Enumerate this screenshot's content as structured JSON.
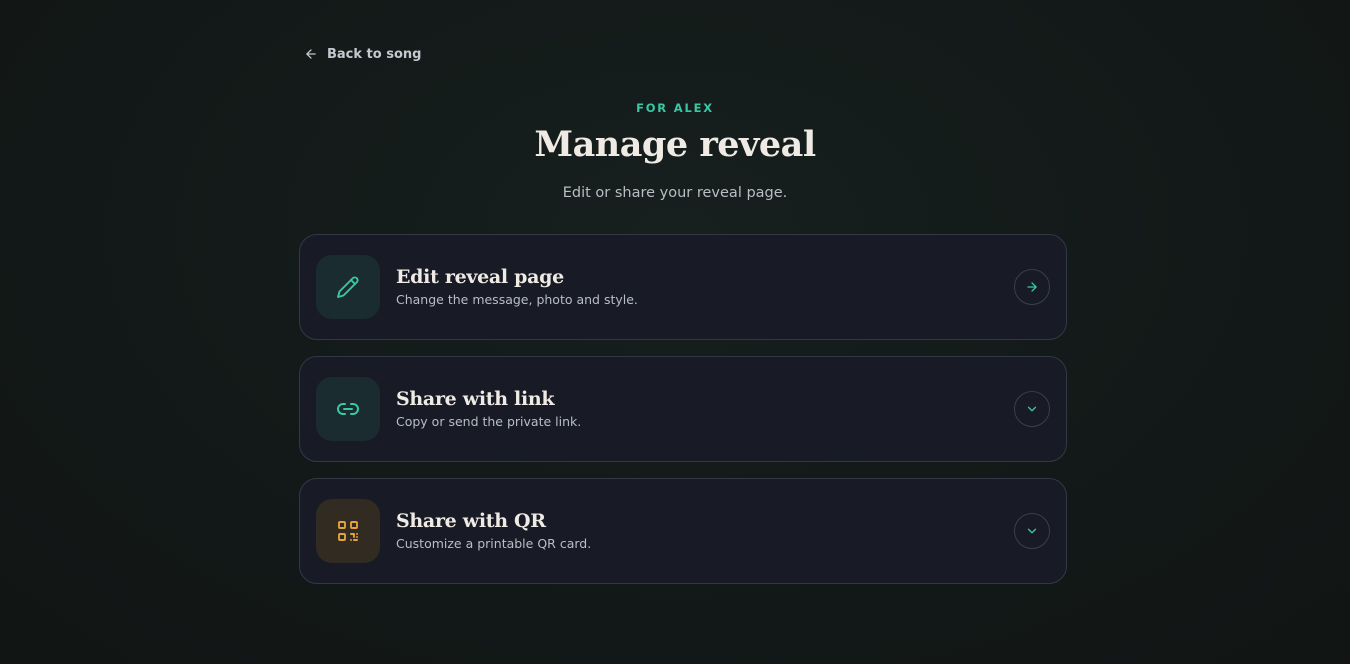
{
  "nav": {
    "back_label": "Back to song"
  },
  "header": {
    "eyebrow": "FOR ALEX",
    "title": "Manage reveal",
    "subtitle": "Edit or share your reveal page."
  },
  "cards": [
    {
      "title": "Edit reveal page",
      "description": "Change the message, photo and style.",
      "icon": "pencil-icon",
      "action_icon": "arrow-right-icon"
    },
    {
      "title": "Share with link",
      "description": "Copy or send the private link.",
      "icon": "link-icon",
      "action_icon": "chevron-down-icon"
    },
    {
      "title": "Share with QR",
      "description": "Customize a printable QR card.",
      "icon": "qr-code-icon",
      "action_icon": "chevron-down-icon"
    }
  ],
  "colors": {
    "accent": "#38c8a6",
    "qr_accent": "#e4a23a",
    "card_bg": "#181b26",
    "page_bg": "#131a19"
  }
}
